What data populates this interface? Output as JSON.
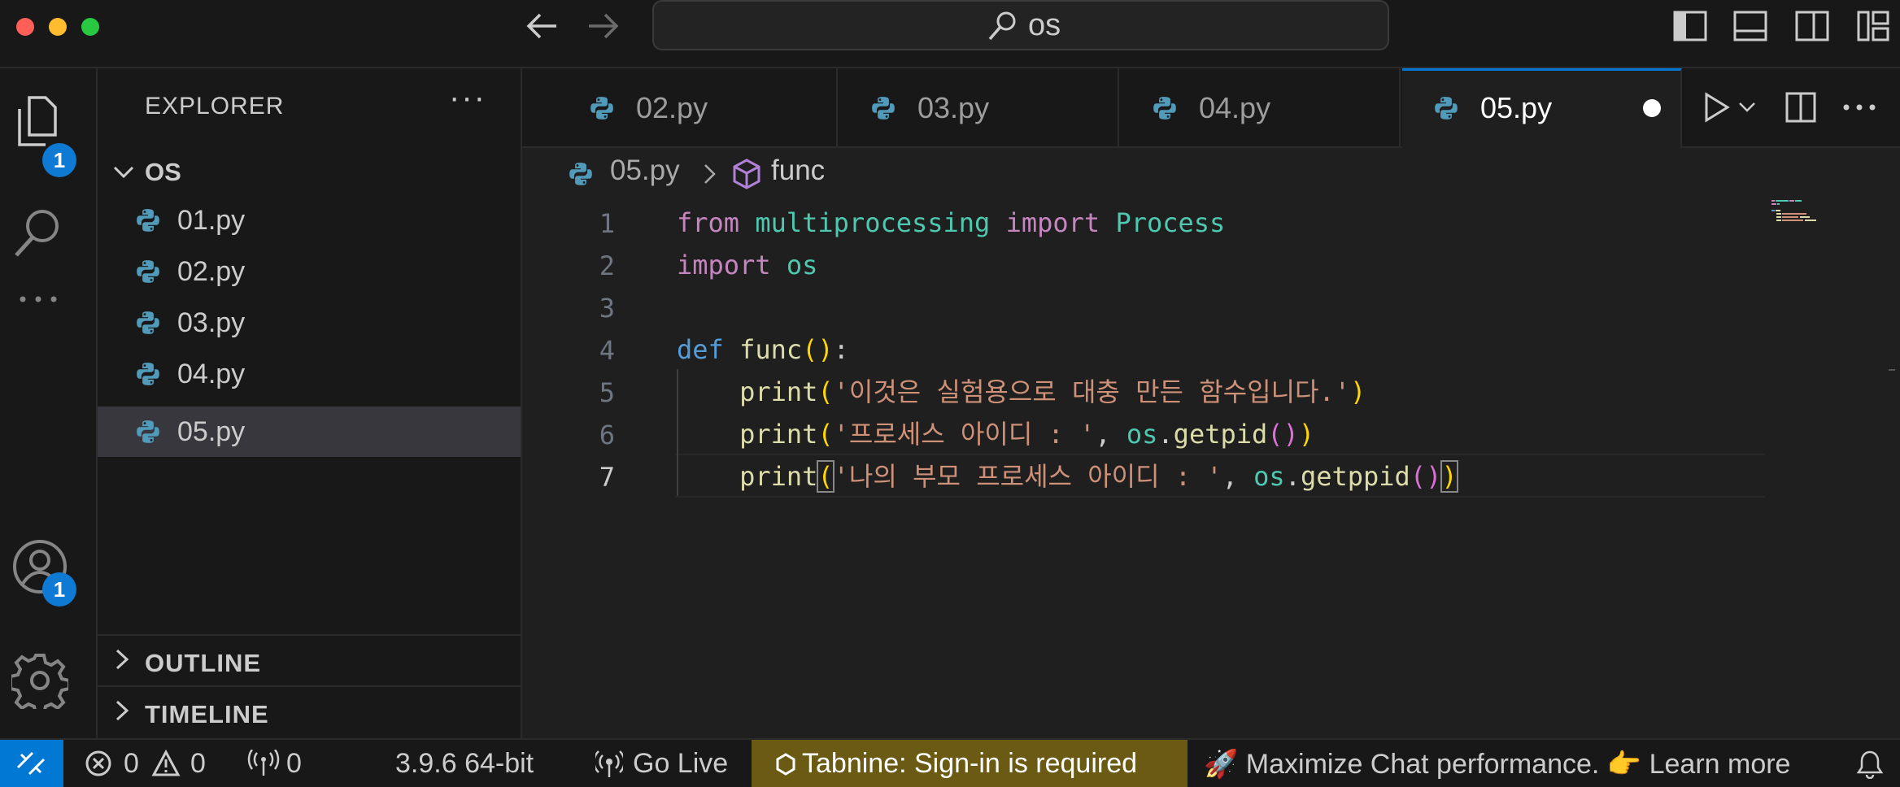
{
  "titlebar": {
    "search_text": "os",
    "back_icon": "arrow-left-icon",
    "forward_icon": "arrow-right-icon"
  },
  "activity": {
    "explorer_badge": "1",
    "accounts_badge": "1"
  },
  "sidebar": {
    "title": "EXPLORER",
    "more": "···",
    "folder": "OS",
    "files": [
      "01.py",
      "02.py",
      "03.py",
      "04.py",
      "05.py"
    ],
    "selected": "05.py",
    "outline": "OUTLINE",
    "timeline": "TIMELINE"
  },
  "tabs": {
    "items": [
      "02.py",
      "03.py",
      "04.py",
      "05.py"
    ],
    "active": "05.py"
  },
  "breadcrumb": {
    "file": "05.py",
    "symbol": "func"
  },
  "editor": {
    "line_numbers": [
      "1",
      "2",
      "3",
      "4",
      "5",
      "6",
      "7"
    ],
    "current_line": "7",
    "lines": [
      "from multiprocessing import Process",
      "import os",
      "",
      "def func():",
      "    print('이것은 실험용으로 대충 만든 함수입니다.')",
      "    print('프로세스 아이디 : ', os.getpid())",
      "    print('나의 부모 프로세스 아이디 : ', os.getppid())"
    ],
    "tokens": {
      "from": "from",
      "multiprocessing": "multiprocessing",
      "import": "import",
      "Process": "Process",
      "os": "os",
      "def": "def",
      "func": "func",
      "print": "print",
      "str5": "'이것은 실험용으로 대충 만든 함수입니다.'",
      "str6": "'프로세스 아이디 : '",
      "str7": "'나의 부모 프로세스 아이디 : '",
      "getpid": "getpid",
      "getppid": "getppid"
    }
  },
  "statusbar": {
    "errors": "0",
    "warnings": "0",
    "ports": "0",
    "python": "3.9.6 64-bit",
    "go_live": "Go Live",
    "tabnine": "Tabnine: Sign-in is required",
    "chat": "🚀 Maximize Chat performance. 👉 Learn more"
  },
  "colors": {
    "accent": "#0078d4",
    "tabnine_bg": "#6b5a14",
    "keyword": "#c586c0",
    "string": "#ce9178",
    "module": "#4ec9b0",
    "function": "#dcdcaa"
  }
}
